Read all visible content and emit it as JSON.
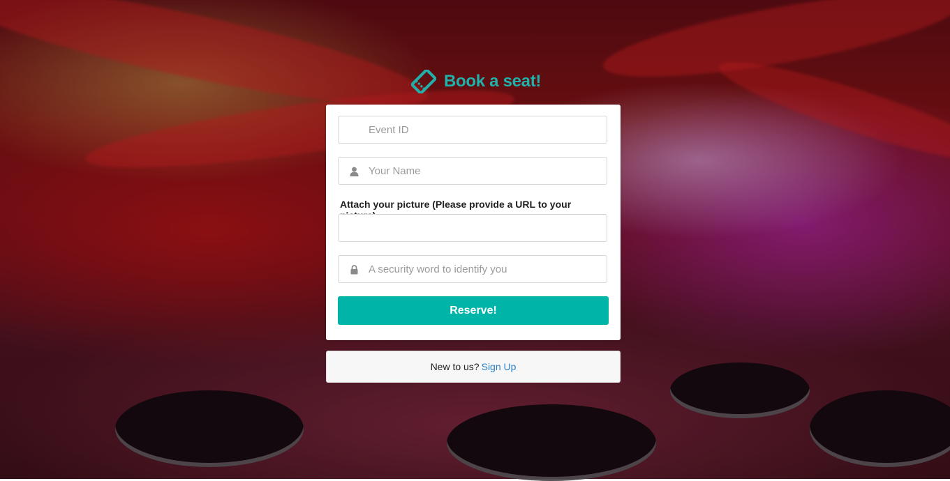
{
  "brand": {
    "title": "Book a seat!",
    "icon": "ticket-icon",
    "color": "#20b2aa"
  },
  "form": {
    "event_id": {
      "value": "",
      "placeholder": "Event ID"
    },
    "name": {
      "value": "",
      "placeholder": "Your Name",
      "icon": "user-icon"
    },
    "picture": {
      "label": "Attach your picture (Please provide a URL to your picture)",
      "value": "",
      "placeholder": ""
    },
    "security_word": {
      "value": "",
      "placeholder": "A security word to identify you",
      "icon": "lock-icon"
    },
    "submit_label": "Reserve!",
    "submit_color": "#00b5a8"
  },
  "signup": {
    "prompt": "New to us?",
    "link_label": "Sign Up",
    "link_color": "#2a7fc4"
  }
}
